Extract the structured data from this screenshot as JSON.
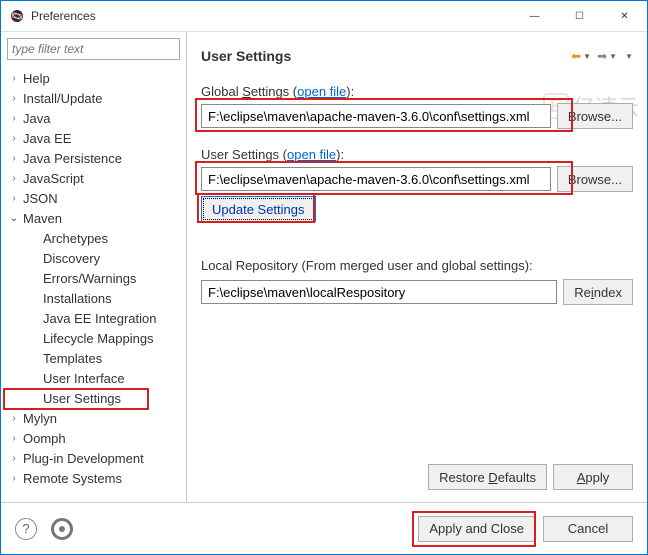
{
  "window": {
    "title": "Preferences",
    "minimize": "—",
    "maximize": "☐",
    "close": "✕"
  },
  "sidebar": {
    "filter_placeholder": "type filter text",
    "items": [
      {
        "label": "Help",
        "expandable": true,
        "expanded": false,
        "depth": 0
      },
      {
        "label": "Install/Update",
        "expandable": true,
        "expanded": false,
        "depth": 0
      },
      {
        "label": "Java",
        "expandable": true,
        "expanded": false,
        "depth": 0
      },
      {
        "label": "Java EE",
        "expandable": true,
        "expanded": false,
        "depth": 0
      },
      {
        "label": "Java Persistence",
        "expandable": true,
        "expanded": false,
        "depth": 0
      },
      {
        "label": "JavaScript",
        "expandable": true,
        "expanded": false,
        "depth": 0
      },
      {
        "label": "JSON",
        "expandable": true,
        "expanded": false,
        "depth": 0
      },
      {
        "label": "Maven",
        "expandable": true,
        "expanded": true,
        "depth": 0
      },
      {
        "label": "Archetypes",
        "expandable": false,
        "expanded": false,
        "depth": 1
      },
      {
        "label": "Discovery",
        "expandable": false,
        "expanded": false,
        "depth": 1
      },
      {
        "label": "Errors/Warnings",
        "expandable": false,
        "expanded": false,
        "depth": 1
      },
      {
        "label": "Installations",
        "expandable": false,
        "expanded": false,
        "depth": 1
      },
      {
        "label": "Java EE Integration",
        "expandable": false,
        "expanded": false,
        "depth": 1
      },
      {
        "label": "Lifecycle Mappings",
        "expandable": false,
        "expanded": false,
        "depth": 1
      },
      {
        "label": "Templates",
        "expandable": false,
        "expanded": false,
        "depth": 1
      },
      {
        "label": "User Interface",
        "expandable": false,
        "expanded": false,
        "depth": 1
      },
      {
        "label": "User Settings",
        "expandable": false,
        "expanded": false,
        "depth": 1,
        "selected": true
      },
      {
        "label": "Mylyn",
        "expandable": true,
        "expanded": false,
        "depth": 0
      },
      {
        "label": "Oomph",
        "expandable": true,
        "expanded": false,
        "depth": 0
      },
      {
        "label": "Plug-in Development",
        "expandable": true,
        "expanded": false,
        "depth": 0
      },
      {
        "label": "Remote Systems",
        "expandable": true,
        "expanded": false,
        "depth": 0
      }
    ]
  },
  "content": {
    "heading": "User Settings",
    "global_label_pre": "Global ",
    "global_label_u": "S",
    "global_label_post": "ettings (",
    "open_file": "open file",
    "close_paren": "):",
    "global_value": "F:\\eclipse\\maven\\apache-maven-3.6.0\\conf\\settings.xml",
    "browse_label": "Browse...",
    "user_label_pre": "User Settin",
    "user_label_u": "g",
    "user_label_post": "s (",
    "user_value": "F:\\eclipse\\maven\\apache-maven-3.6.0\\conf\\settings.xml",
    "update_label": "Update Settings",
    "local_repo_label": "Local Repository (From merged user and global settings):",
    "local_repo_value": "F:\\eclipse\\maven\\localRespository",
    "reindex_label": "Reindex",
    "restore_label": "Restore Defaults",
    "apply_label": "Apply"
  },
  "footer": {
    "help": "?",
    "apply_close": "Apply and Close",
    "cancel": "Cancel"
  },
  "watermark": "亿速云"
}
